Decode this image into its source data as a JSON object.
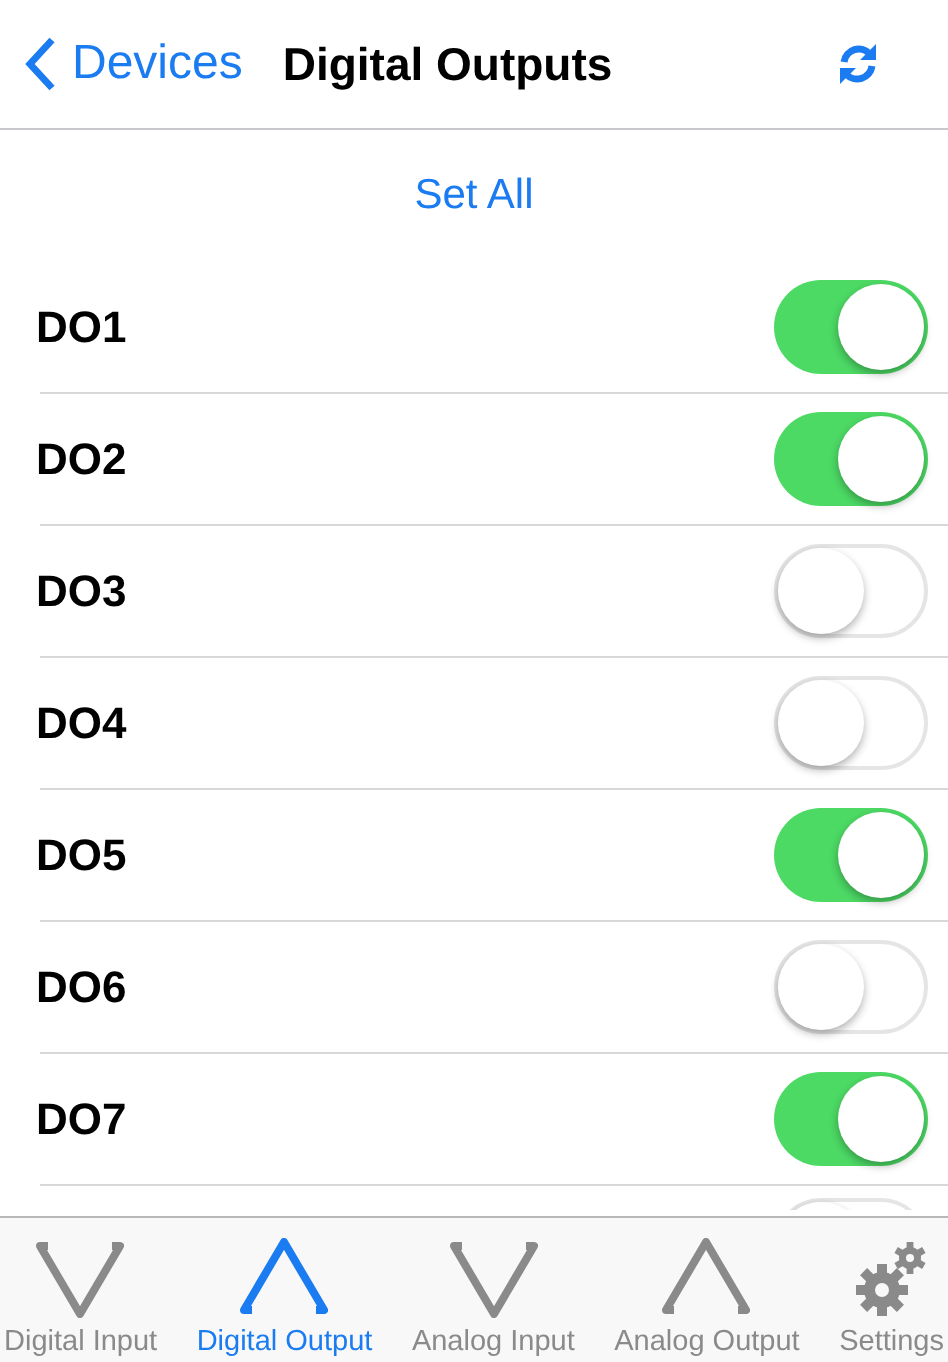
{
  "nav_bar": {
    "back": "Devices",
    "title": "Digital Outputs"
  },
  "set_all": "Set All",
  "outputs": [
    {
      "name": "DO1",
      "on": true
    },
    {
      "name": "DO2",
      "on": true
    },
    {
      "name": "DO3",
      "on": false
    },
    {
      "name": "DO4",
      "on": false
    },
    {
      "name": "DO5",
      "on": true
    },
    {
      "name": "DO6",
      "on": false
    },
    {
      "name": "DO7",
      "on": true
    },
    {
      "on": false
    }
  ],
  "tab_bar": [
    {
      "label": "Digital Input",
      "kind": "down",
      "selected": false
    },
    {
      "label": "Digital Output",
      "kind": "up",
      "selected": true
    },
    {
      "label": "Analog Input",
      "kind": "down",
      "selected": false
    },
    {
      "label": "Analog Output",
      "kind": "up",
      "selected": false
    },
    {
      "label": "Settings",
      "kind": "gears",
      "selected": false
    }
  ]
}
